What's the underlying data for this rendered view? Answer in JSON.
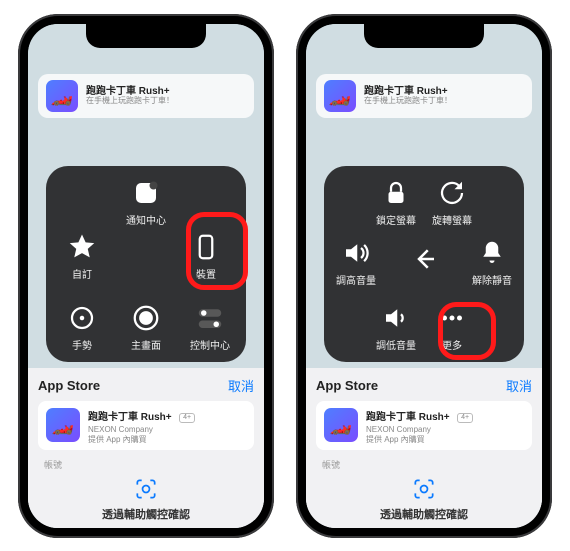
{
  "banner": {
    "title": "跑跑卡丁車 Rush+",
    "subtitle": "在手機上玩跑跑卡丁車！"
  },
  "left_panel": {
    "notification_center": "通知中心",
    "custom": "自訂",
    "device": "裝置",
    "gesture": "手勢",
    "control_center": "控制中心",
    "home": "主畫面"
  },
  "right_panel": {
    "lock_screen": "鎖定螢幕",
    "rotate_screen": "旋轉螢幕",
    "volume_up": "調高音量",
    "unmute": "解除靜音",
    "volume_down": "調低音量",
    "more": "更多"
  },
  "sheet": {
    "title": "App Store",
    "cancel": "取消",
    "app_name": "跑跑卡丁車 Rush+",
    "age_badge": "4+",
    "company": "NEXON Company",
    "iap": "提供 App 內購買",
    "account_label": "帳號"
  },
  "confirm": "透過輔助觸控確認"
}
